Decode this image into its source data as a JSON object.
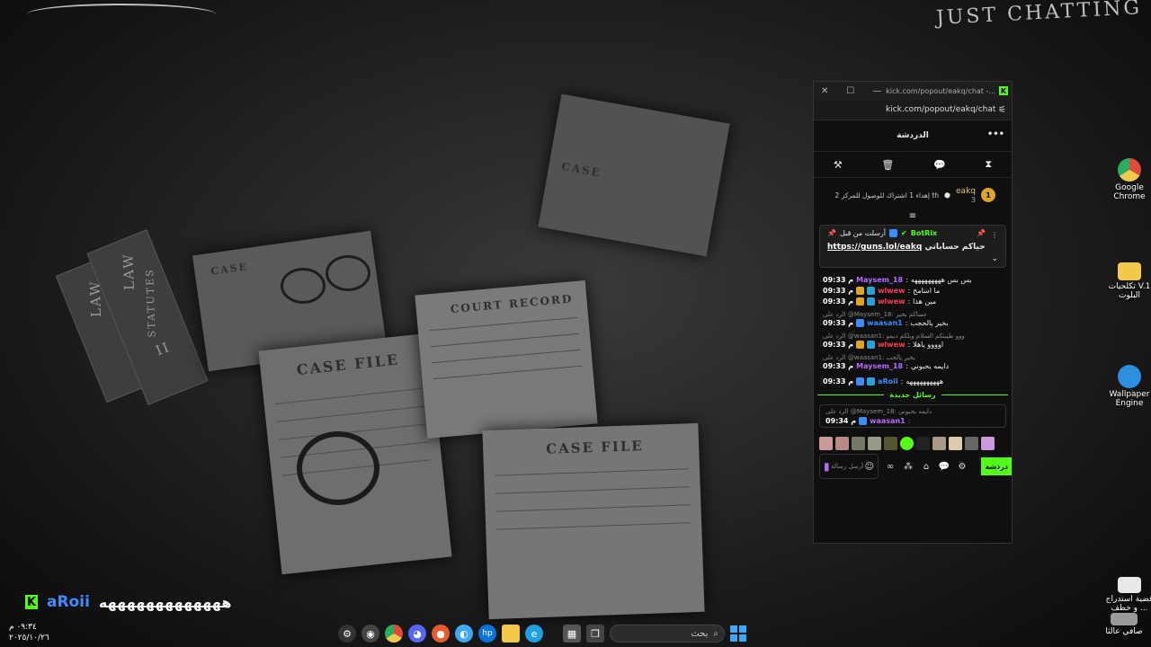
{
  "desktop": {
    "watermark": "JUST CHATTING",
    "backdrop": {
      "case_file": "CASE FILE",
      "court_record": "COURT RECORD",
      "case": "CASE",
      "law": "LAW",
      "statutes": "STATUTES",
      "vol": "II"
    },
    "icons": [
      {
        "label": "Google Chrome",
        "color": "#dd4b39"
      },
      {
        "label": "تكلحيات V.1 البلوت",
        "color": "#f2c94c"
      },
      {
        "label": "Wallpaper Engine",
        "color": "#2d8fe0"
      },
      {
        "label": "قضية استدراج ... و خطف",
        "color": "#e8e8e8"
      },
      {
        "label": "صافي عالثا",
        "color": "#9a9a9a"
      }
    ],
    "overlay": {
      "k": "K",
      "name": "aRoii",
      "message": "هههههههههههههه"
    },
    "clock": {
      "time": "٠٩:٣٤ م",
      "date": "٢٠٢٥/١٠/٢٦"
    },
    "taskbar": {
      "search_placeholder": "بحث"
    }
  },
  "popout": {
    "tab_url": "kick.com/popout/eakq/chat -...",
    "url": "kick.com/popout/eakq/chat",
    "header_title": "الدردشة",
    "goal": {
      "rank": "1",
      "user": "eakq",
      "count": "3",
      "text": "إهداء 1 اشتراك للوصول للمركز 2 th"
    },
    "pinned": {
      "sender": "BotRix",
      "prefix": "أرسلت من قبل",
      "body_prefix": "حياكم حساباتي",
      "link": "https://guns.lol/eakq"
    },
    "messages": [
      {
        "time": "09:33 م",
        "name": "Maysem_18",
        "color": "#b469ff",
        "text": "بس بس هههههههههه",
        "badges": []
      },
      {
        "time": "09:33 م",
        "name": "wlwew",
        "color": "#ff3a55",
        "text": "ما اسامح",
        "badges": [
          "crown",
          "sub"
        ]
      },
      {
        "time": "09:33 م",
        "name": "wlwew",
        "color": "#ff3a55",
        "text": "مين هذا",
        "badges": [
          "crown",
          "sub"
        ]
      },
      {
        "reply": "الرد على @Maysem_18: عساكم بخير",
        "time": "09:33 م",
        "name": "waasan1",
        "color": "#3d8bff",
        "text": "بخير يالحجب",
        "badges": [
          "arrow"
        ]
      },
      {
        "reply": "الرد على @waasan1: ووو طيبتكم السلام وبلكم ديمو",
        "time": "09:33 م",
        "name": "wlwew",
        "color": "#ff3a55",
        "text": "اوووو ياهلا",
        "badges": [
          "crown",
          "sub"
        ]
      },
      {
        "reply": "الرد على @waasan1: بخير يالحب",
        "time": "09:33 م",
        "name": "Maysem_18",
        "color": "#b469ff",
        "text": "دايمه يحبوني",
        "badges": []
      },
      {
        "time": "09:33 م",
        "name": "aRoii",
        "color": "#3d8bff",
        "text": "ههههههههههه",
        "badges": [
          "arrow",
          "sub"
        ]
      }
    ],
    "new_messages_label": "رسائل جديدة",
    "latest": {
      "reply": "الرد على @Maysem_18: دايمه يحبوني",
      "time": "09:34 م",
      "name": "waasan1",
      "color": "#b469ff",
      "text": ""
    },
    "input_placeholder": "أرسل رسالة",
    "send_label": "دردشة",
    "accent": "#53fc18"
  }
}
